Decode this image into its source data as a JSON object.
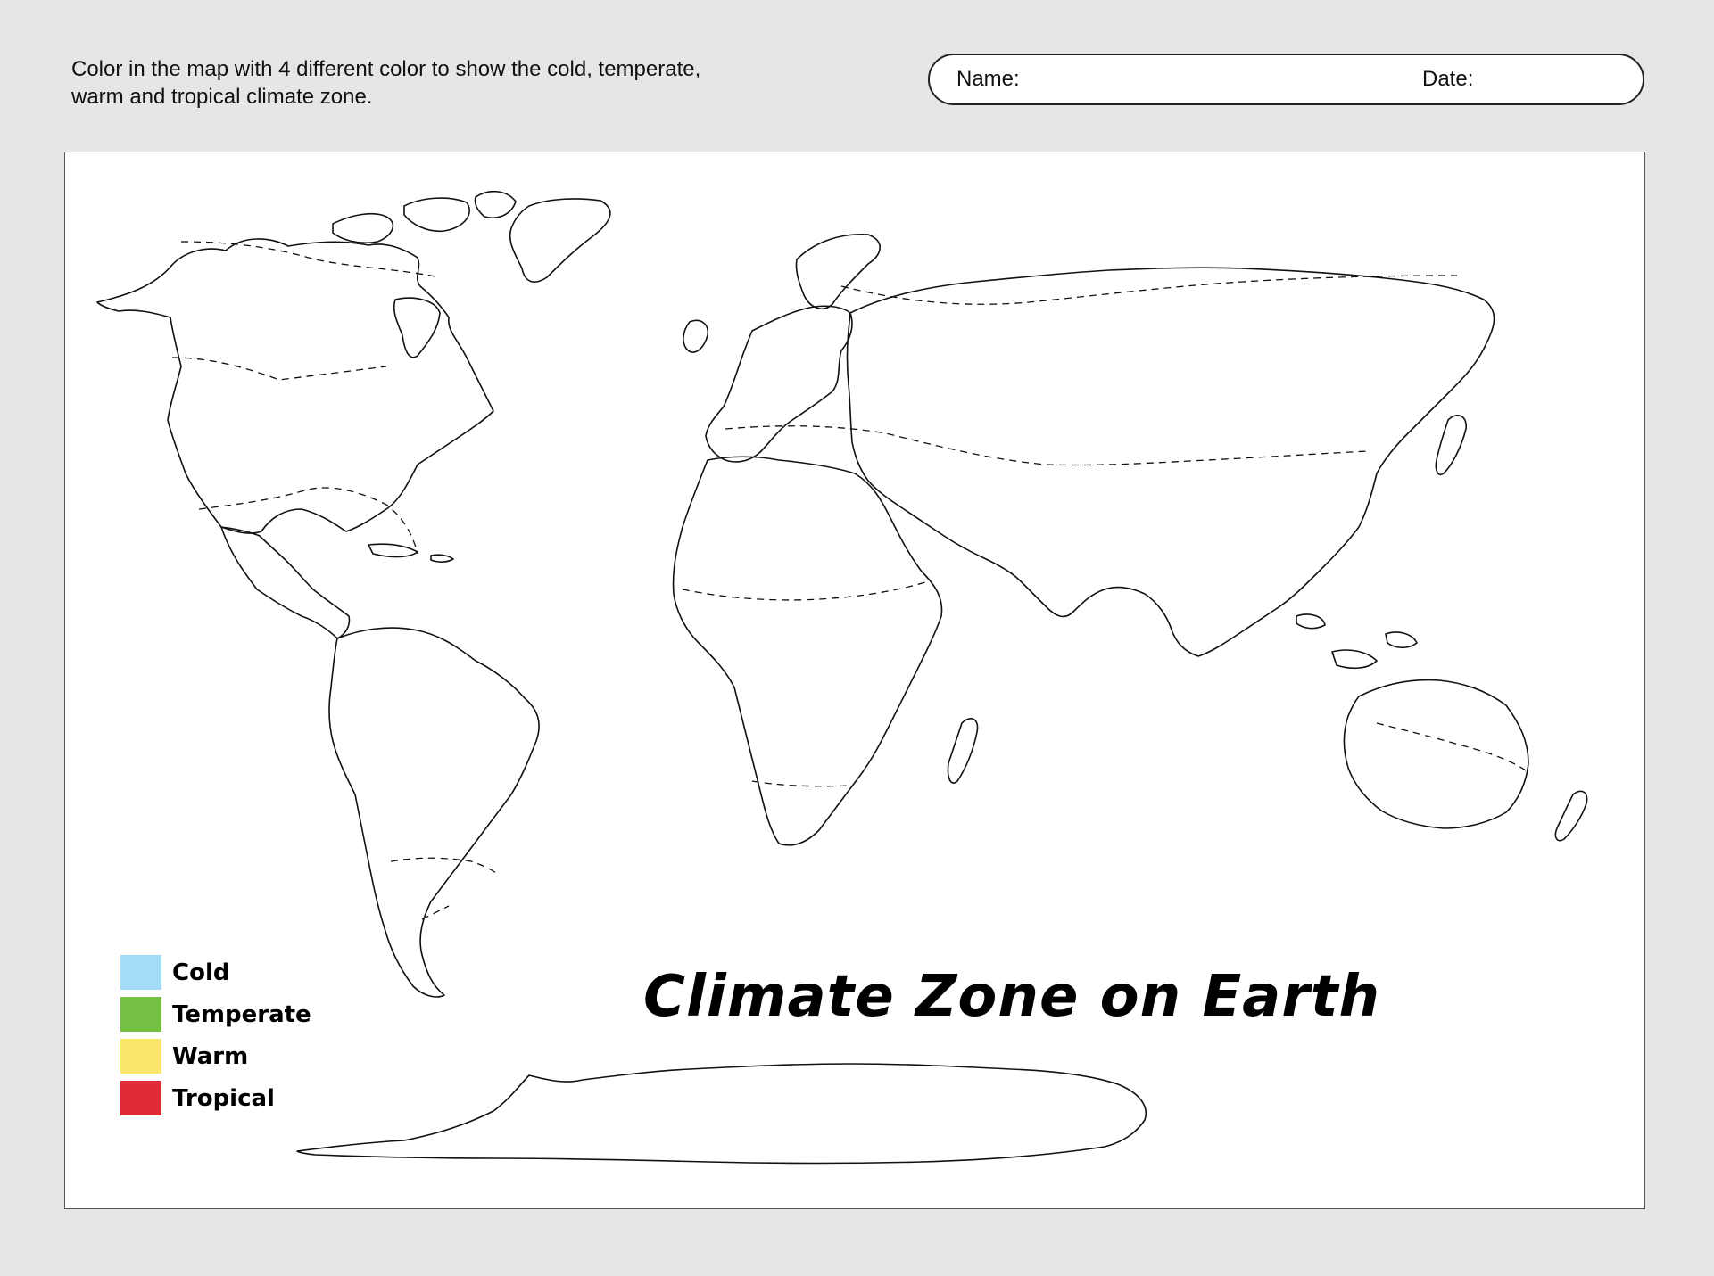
{
  "header": {
    "instructions": "Color in the map with 4 different color to show the cold, temperate, warm and tropical climate zone.",
    "name_label": "Name:",
    "date_label": "Date:"
  },
  "map": {
    "title": "Climate Zone on Earth"
  },
  "legend": {
    "items": [
      {
        "label": "Cold",
        "color": "#a3dcf7"
      },
      {
        "label": "Temperate",
        "color": "#74c043"
      },
      {
        "label": "Warm",
        "color": "#fae56b"
      },
      {
        "label": "Tropical",
        "color": "#e02a38"
      }
    ]
  }
}
